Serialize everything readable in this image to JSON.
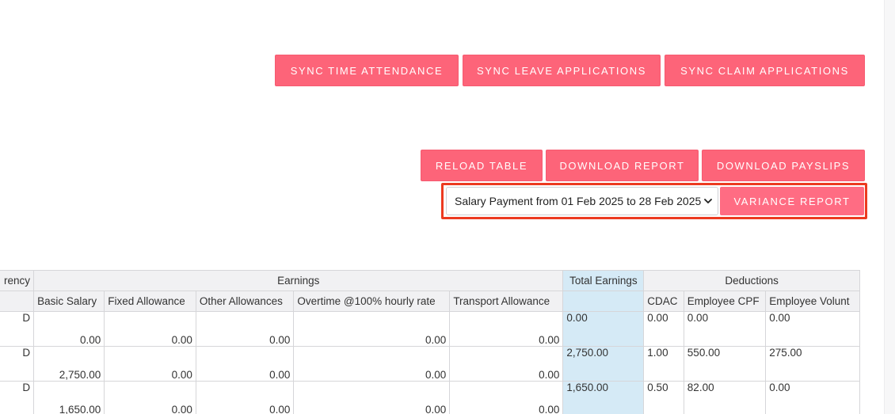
{
  "sync_buttons": [
    {
      "label": "SYNC TIME ATTENDANCE"
    },
    {
      "label": "SYNC LEAVE APPLICATIONS"
    },
    {
      "label": "SYNC CLAIM APPLICATIONS"
    }
  ],
  "report_buttons": [
    {
      "label": "RELOAD TABLE"
    },
    {
      "label": "DOWNLOAD REPORT"
    },
    {
      "label": "DOWNLOAD PAYSLIPS"
    }
  ],
  "variance": {
    "select_value": "Salary Payment from 01 Feb 2025 to 28 Feb 2025",
    "button_label": "VARIANCE REPORT"
  },
  "table": {
    "group_headers": {
      "currency": "rency",
      "earnings": "Earnings",
      "total_earnings": "Total Earnings",
      "deductions": "Deductions"
    },
    "columns": [
      "Basic Salary",
      "Fixed Allowance",
      "Other Allowances",
      "Overtime @100% hourly rate",
      "Transport Allowance",
      "CDAC",
      "Employee CPF",
      "Employee Volunt"
    ],
    "rows": [
      {
        "currency": "D",
        "basic": "0.00",
        "fixed": "0.00",
        "other": "0.00",
        "overtime": "0.00",
        "transport": "0.00",
        "total": "0.00",
        "cdac": "0.00",
        "cpf": "0.00",
        "voluntary": "0.00"
      },
      {
        "currency": "D",
        "basic": "2,750.00",
        "fixed": "0.00",
        "other": "0.00",
        "overtime": "0.00",
        "transport": "0.00",
        "total": "2,750.00",
        "cdac": "1.00",
        "cpf": "550.00",
        "voluntary": "275.00"
      },
      {
        "currency": "D",
        "basic": "1,650.00",
        "fixed": "0.00",
        "other": "0.00",
        "overtime": "0.00",
        "transport": "0.00",
        "total": "1,650.00",
        "cdac": "0.50",
        "cpf": "82.00",
        "voluntary": "0.00"
      }
    ]
  }
}
